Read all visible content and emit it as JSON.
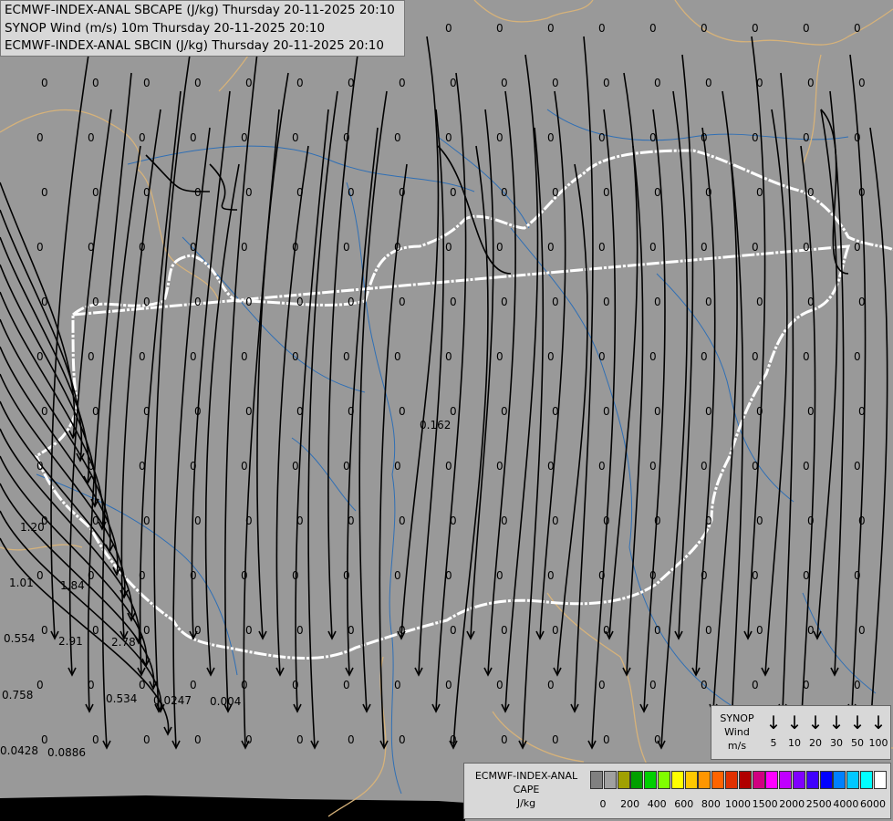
{
  "header": {
    "line1": "ECMWF-INDEX-ANAL SBCAPE (J/kg) Thursday 20-11-2025 20:10",
    "line2": "SYNOP Wind (m/s) 10m Thursday 20-11-2025 20:10",
    "line3": "ECMWF-INDEX-ANAL SBCIN (J/kg) Thursday 20-11-2025 20:10"
  },
  "map": {
    "background_color": "#999999",
    "border_color": "#d6b27a",
    "country_border_color": "#ffffff",
    "river_color": "#2f6fb5",
    "streamline_color": "#000000",
    "sea_color": "#000000",
    "wind_direction": "northerly flow, streamlines curving southward",
    "cape_values": [
      {
        "label": "0"
      },
      {
        "label": "0.162"
      },
      {
        "label": "1.20"
      },
      {
        "label": "1.01"
      },
      {
        "label": "1.84"
      },
      {
        "label": "0.554"
      },
      {
        "label": "2.91"
      },
      {
        "label": "2.78"
      },
      {
        "label": "0.758"
      },
      {
        "label": "0.534"
      },
      {
        "label": "0.0247"
      },
      {
        "label": "0.004"
      },
      {
        "label": "0.0428"
      },
      {
        "label": "0.0886"
      }
    ]
  },
  "wind_legend": {
    "title_line1": "SYNOP",
    "title_line2": "Wind",
    "title_line3": "m/s",
    "speeds": [
      "5",
      "10",
      "20",
      "30",
      "50",
      "100"
    ]
  },
  "cape_legend": {
    "title_line1": "ECMWF-INDEX-ANAL",
    "title_line2": "CAPE",
    "title_line3": "J/kg",
    "ticks": [
      "0",
      "200",
      "400",
      "600",
      "800",
      "1000",
      "1500",
      "2000",
      "2500",
      "4000",
      "6000"
    ],
    "colors": [
      "#808080",
      "#a0a0a0",
      "#a0a000",
      "#00a000",
      "#00d000",
      "#80ff00",
      "#ffff00",
      "#ffc800",
      "#ff9600",
      "#ff6400",
      "#e03000",
      "#b00000",
      "#d00080",
      "#ff00ff",
      "#c000ff",
      "#8000ff",
      "#4000ff",
      "#0000ff",
      "#0080ff",
      "#00c8ff",
      "#00ffff",
      "#ffffff"
    ]
  }
}
